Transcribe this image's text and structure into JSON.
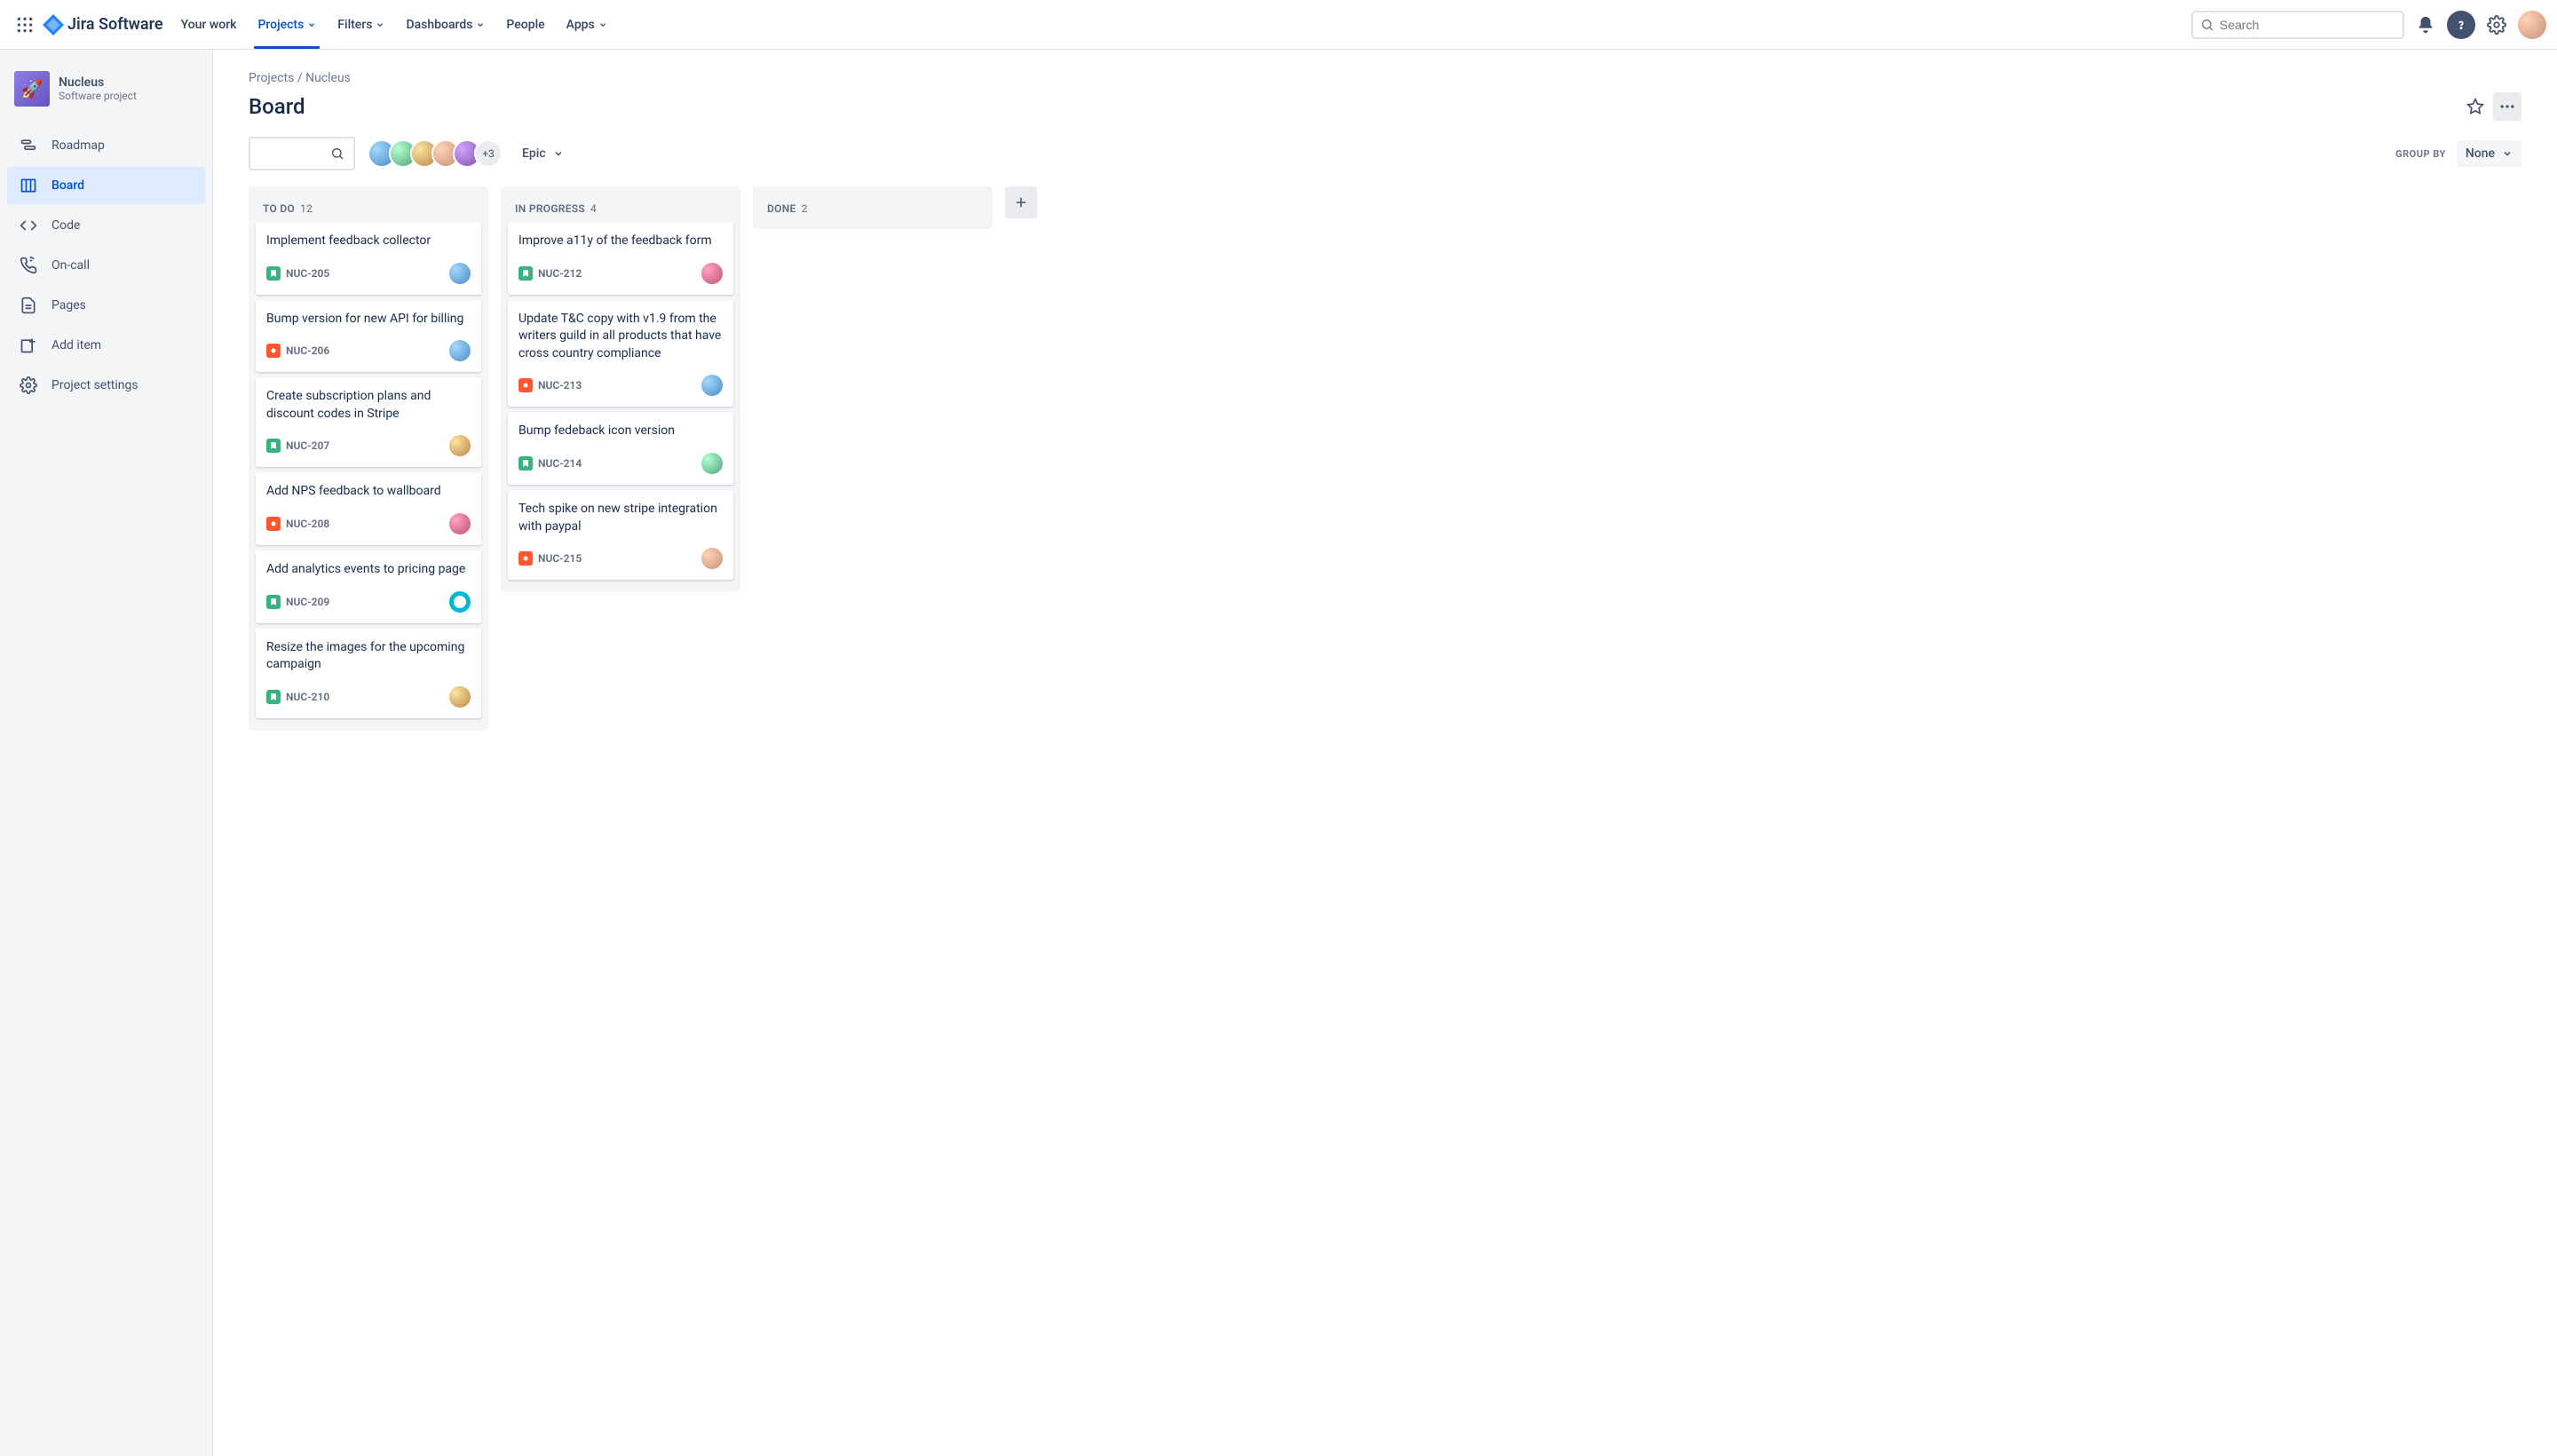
{
  "header": {
    "logo_text": "Jira Software",
    "nav": {
      "your_work": "Your work",
      "projects": "Projects",
      "filters": "Filters",
      "dashboards": "Dashboards",
      "people": "People",
      "apps": "Apps"
    },
    "search_placeholder": "Search"
  },
  "sidebar": {
    "project": {
      "name": "Nucleus",
      "type": "Software project"
    },
    "items": [
      {
        "label": "Roadmap"
      },
      {
        "label": "Board"
      },
      {
        "label": "Code"
      },
      {
        "label": "On-call"
      },
      {
        "label": "Pages"
      },
      {
        "label": "Add item"
      },
      {
        "label": "Project settings"
      }
    ]
  },
  "breadcrumb": {
    "projects": "Projects",
    "sep": " / ",
    "current": "Nucleus"
  },
  "page": {
    "title": "Board"
  },
  "toolbar": {
    "avatar_overflow": "+3",
    "epic_label": "Epic",
    "groupby_label": "GROUP BY",
    "groupby_value": "None"
  },
  "columns": [
    {
      "name": "TO DO",
      "count": "12",
      "cards": [
        {
          "title": "Implement feedback collector",
          "key": "NUC-205",
          "type": "story",
          "avatar": "av4"
        },
        {
          "title": "Bump version for new API for billing",
          "key": "NUC-206",
          "type": "bug",
          "avatar": "av4"
        },
        {
          "title": "Create subscription plans and discount codes in Stripe",
          "key": "NUC-207",
          "type": "story",
          "avatar": "av3"
        },
        {
          "title": "Add NPS feedback to wallboard",
          "key": "NUC-208",
          "type": "bug",
          "avatar": "av5"
        },
        {
          "title": "Add analytics events to pricing page",
          "key": "NUC-209",
          "type": "story",
          "avatar": "av7"
        },
        {
          "title": "Resize the images for the upcoming campaign",
          "key": "NUC-210",
          "type": "story",
          "avatar": "av3"
        }
      ]
    },
    {
      "name": "IN PROGRESS",
      "count": "4",
      "cards": [
        {
          "title": "Improve a11y of the feedback form",
          "key": "NUC-212",
          "type": "story",
          "avatar": "av5"
        },
        {
          "title": "Update T&C copy with v1.9 from the writers guild in all products that have cross country compliance",
          "key": "NUC-213",
          "type": "bug",
          "avatar": "av4"
        },
        {
          "title": "Bump fedeback icon version",
          "key": "NUC-214",
          "type": "story",
          "avatar": "av6"
        },
        {
          "title": "Tech spike on new stripe integration with paypal",
          "key": "NUC-215",
          "type": "bug",
          "avatar": "av1"
        }
      ]
    },
    {
      "name": "DONE",
      "count": "2",
      "cards": []
    }
  ]
}
